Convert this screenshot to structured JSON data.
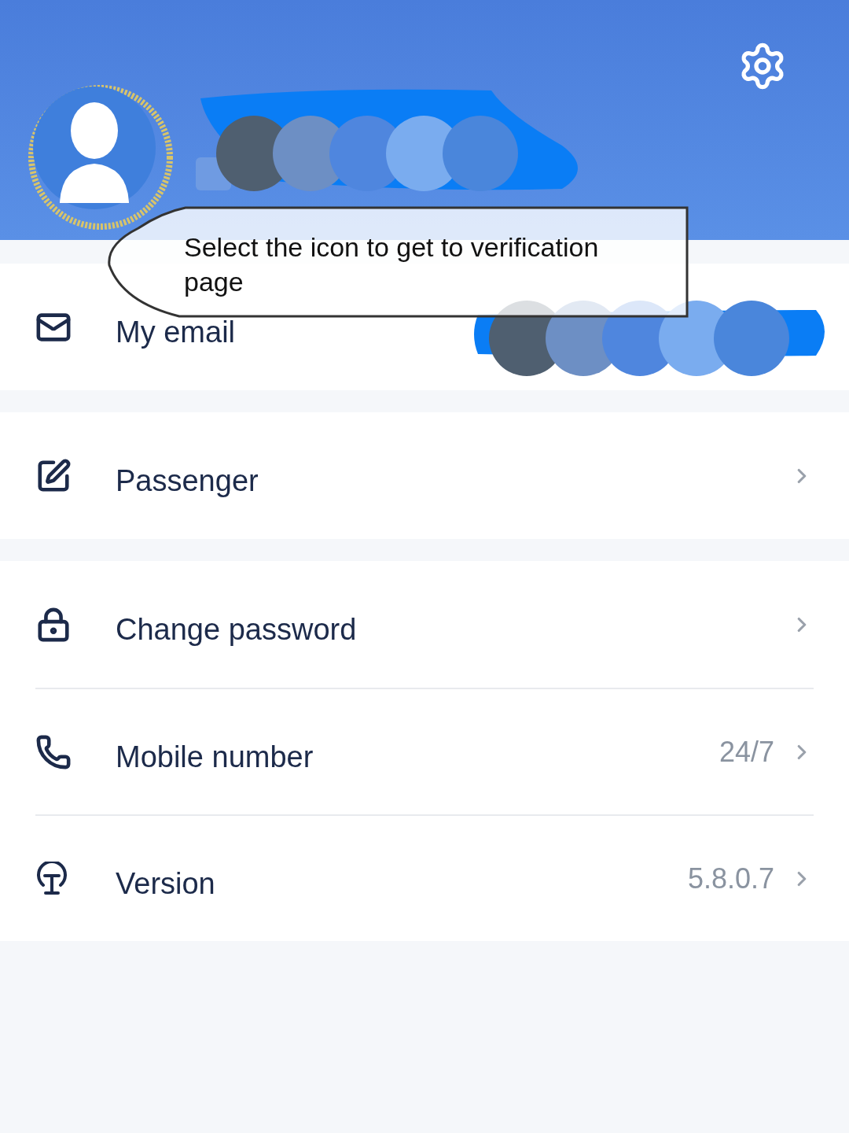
{
  "callout": {
    "text": "Select the icon to get to verification page"
  },
  "sections": [
    {
      "items": [
        {
          "kind": "email",
          "label": "My email",
          "chevron": false
        }
      ]
    },
    {
      "items": [
        {
          "kind": "edit",
          "label": "Passenger",
          "chevron": true
        }
      ]
    },
    {
      "items": [
        {
          "kind": "lock",
          "label": "Change password",
          "chevron": true
        },
        {
          "kind": "phone",
          "label": "Mobile number",
          "value": "24/7",
          "chevron": true
        },
        {
          "kind": "version",
          "label": "Version",
          "value": "5.8.0.7",
          "chevron": true
        }
      ]
    }
  ]
}
